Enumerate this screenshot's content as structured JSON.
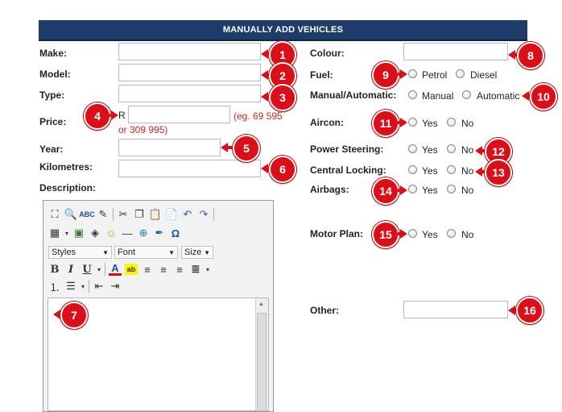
{
  "header": {
    "title": "MANUALLY ADD VEHICLES"
  },
  "left": {
    "make_label": "Make:",
    "model_label": "Model:",
    "type_label": "Type:",
    "price_label": "Price:",
    "currency": "R",
    "price_hint_1": "(eg. 69 595",
    "price_hint_2": "or 309 995)",
    "year_label": "Year:",
    "km_label": "Kilometres:",
    "desc_label": "Description:"
  },
  "editor": {
    "styles": "Styles",
    "font": "Font",
    "size": "Size"
  },
  "right": {
    "colour_label": "Colour:",
    "fuel_label": "Fuel:",
    "fuel_opt1": "Petrol",
    "fuel_opt2": "Diesel",
    "trans_label": "Manual/Automatic:",
    "trans_opt1": "Manual",
    "trans_opt2": "Automatic",
    "aircon_label": "Aircon:",
    "ps_label": "Power Steering:",
    "cl_label": "Central Locking:",
    "airbags_label": "Airbags:",
    "motor_label": "Motor Plan:",
    "other_label": "Other:",
    "yes": "Yes",
    "no": "No"
  },
  "callouts": [
    "1",
    "2",
    "3",
    "4",
    "5",
    "6",
    "7",
    "8",
    "9",
    "10",
    "11",
    "12",
    "13",
    "14",
    "15",
    "16"
  ],
  "colors": {
    "header_bg": "#1d3c6a",
    "callout": "#d9101a",
    "hint": "#cc2222"
  }
}
